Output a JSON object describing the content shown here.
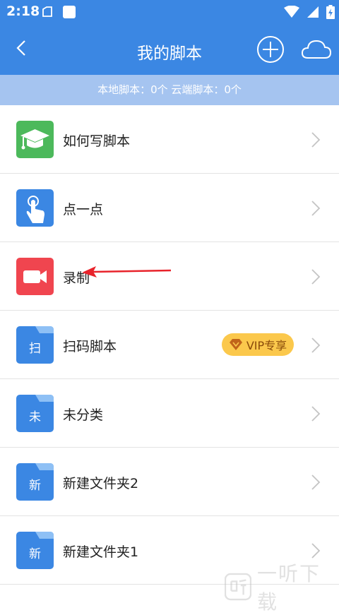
{
  "status_bar": {
    "time": "2:18"
  },
  "header": {
    "title": "我的脚本"
  },
  "summary": {
    "text": "本地脚本：0个  云端脚本：0个"
  },
  "items": [
    {
      "label": "如何写脚本",
      "icon": "graduation-cap-icon",
      "color": "#4cb95b"
    },
    {
      "label": "点一点",
      "icon": "tap-hand-icon",
      "color": "#3b87e3"
    },
    {
      "label": "录制",
      "icon": "video-camera-icon",
      "color": "#f0454f"
    },
    {
      "label": "扫码脚本",
      "icon": "folder-icon",
      "folder_letter": "扫",
      "badge": "VIP专享",
      "color": "#3b87e3"
    },
    {
      "label": "未分类",
      "icon": "folder-icon",
      "folder_letter": "未",
      "color": "#3b87e3"
    },
    {
      "label": "新建文件夹2",
      "icon": "folder-icon",
      "folder_letter": "新",
      "color": "#3b87e3"
    },
    {
      "label": "新建文件夹1",
      "icon": "folder-icon",
      "folder_letter": "新",
      "color": "#3b87e3"
    }
  ],
  "watermark": {
    "text": "一听下载"
  }
}
